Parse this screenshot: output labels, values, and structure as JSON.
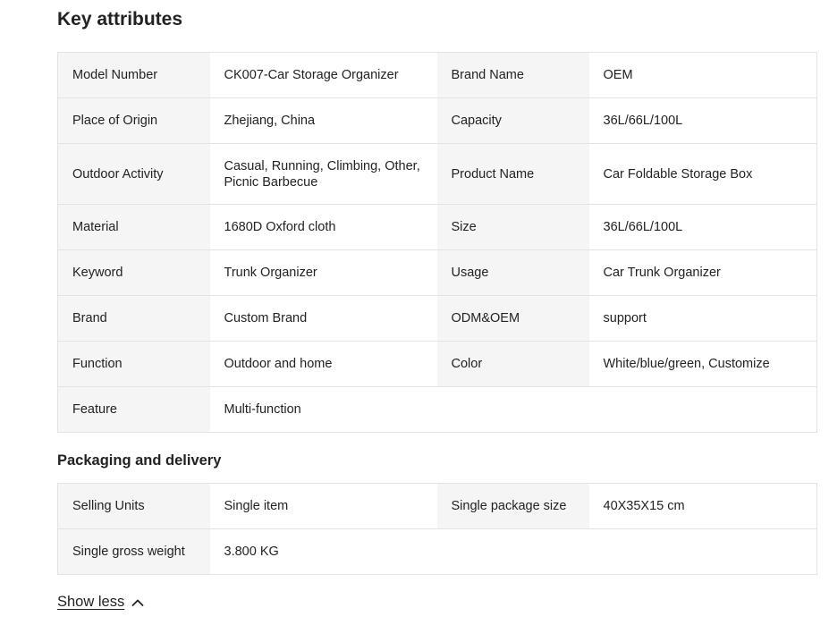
{
  "section_title": "Key attributes",
  "attributes": [
    [
      {
        "k": "Model Number",
        "v": "CK007-Car Storage Organizer"
      },
      {
        "k": "Brand Name",
        "v": "OEM"
      }
    ],
    [
      {
        "k": "Place of Origin",
        "v": "Zhejiang, China"
      },
      {
        "k": "Capacity",
        "v": "36L/66L/100L"
      }
    ],
    [
      {
        "k": "Outdoor Activity",
        "v": "Casual, Running, Climbing, Other, Picnic Barbecue"
      },
      {
        "k": "Product Name",
        "v": "Car Foldable Storage Box"
      }
    ],
    [
      {
        "k": "Material",
        "v": "1680D Oxford cloth"
      },
      {
        "k": "Size",
        "v": "36L/66L/100L"
      }
    ],
    [
      {
        "k": "Keyword",
        "v": "Trunk Organizer"
      },
      {
        "k": "Usage",
        "v": "Car Trunk Organizer"
      }
    ],
    [
      {
        "k": "Brand",
        "v": "Custom Brand"
      },
      {
        "k": "ODM&OEM",
        "v": "support"
      }
    ],
    [
      {
        "k": "Function",
        "v": "Outdoor and home"
      },
      {
        "k": "Color",
        "v": "White/blue/green, Customize"
      }
    ],
    [
      {
        "k": "Feature",
        "v": "Multi-function"
      },
      {
        "k": "",
        "v": ""
      }
    ]
  ],
  "packaging_title": "Packaging and delivery",
  "packaging": [
    [
      {
        "k": "Selling Units",
        "v": "Single item"
      },
      {
        "k": "Single package size",
        "v": "40X35X15 cm"
      }
    ],
    [
      {
        "k": "Single gross weight",
        "v": "3.800 KG"
      },
      {
        "k": "",
        "v": ""
      }
    ]
  ],
  "show_less_label": "Show less",
  "show_less_icon": "chevron-up-icon"
}
